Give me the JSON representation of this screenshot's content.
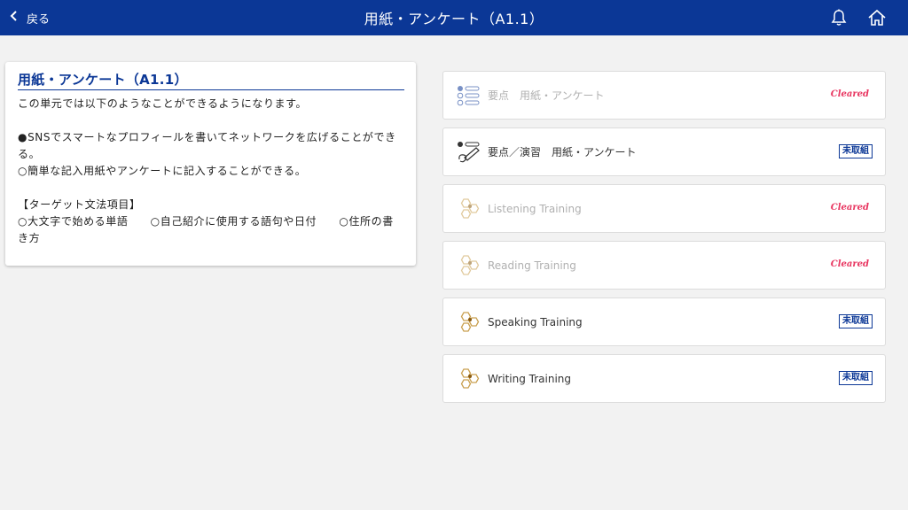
{
  "header": {
    "back_label": "戻る",
    "title": "用紙・アンケート（A1.1）"
  },
  "info": {
    "heading": "用紙・アンケート（A1.1）",
    "description": "この単元では以下のようなことができるようになります。\n\n●SNSでスマートなプロフィールを書いてネットワークを広げることができる。\n○簡単な記入用紙やアンケートに記入することができる。\n\n【ターゲット文法項目】\n○大文字で始める単語　　○自己紹介に使用する語句や日付　　○住所の書き方"
  },
  "lessons": [
    {
      "label": "要点　用紙・アンケート",
      "icon": "list-icon",
      "status": "Cleared",
      "cleared": true
    },
    {
      "label": "要点／演習　用紙・アンケート",
      "icon": "pen-icon",
      "status": "未取組",
      "cleared": false
    },
    {
      "label": "Listening Training",
      "icon": "hexagon-network-icon",
      "status": "Cleared",
      "cleared": true
    },
    {
      "label": "Reading Training",
      "icon": "hexagon-network-icon",
      "status": "Cleared",
      "cleared": true
    },
    {
      "label": "Speaking Training",
      "icon": "hexagon-network-icon",
      "status": "未取組",
      "cleared": false
    },
    {
      "label": "Writing Training",
      "icon": "hexagon-network-icon",
      "status": "未取組",
      "cleared": false
    }
  ],
  "colors": {
    "header": "#0b3796",
    "accent": "#0b3796",
    "cleared": "#e8345f",
    "hex_icon": "#c9a050"
  }
}
